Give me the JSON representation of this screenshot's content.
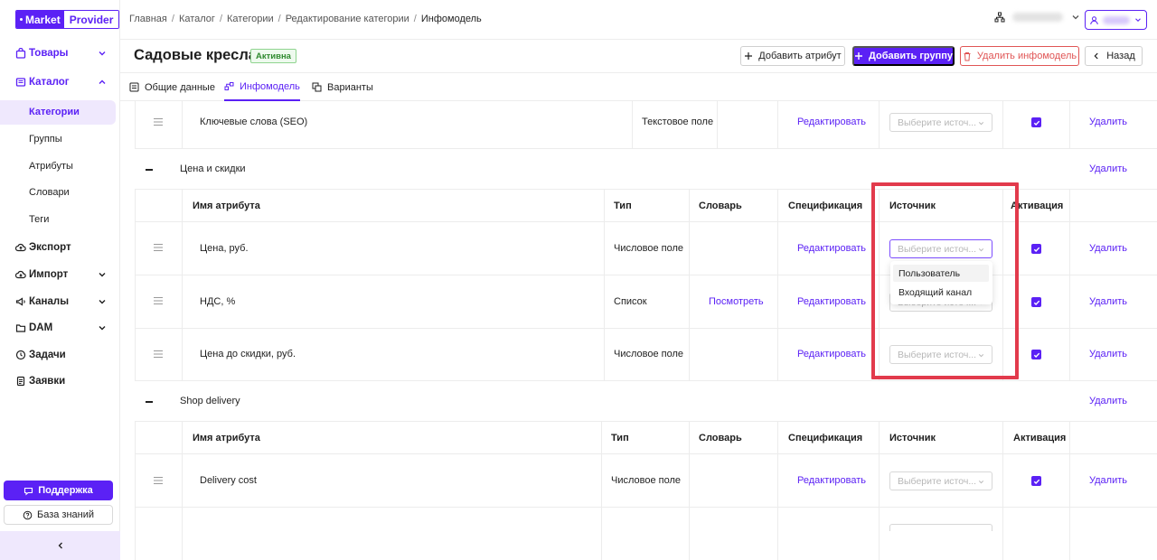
{
  "app": {
    "logo": {
      "part1": "Market",
      "part2": "Provider"
    },
    "accent": "#5b21f5"
  },
  "sidebar": {
    "items": [
      {
        "label": "Товары",
        "icon": "bag-icon"
      },
      {
        "label": "Каталог",
        "icon": "catalog-icon"
      },
      {
        "label": "Экспорт",
        "icon": "export-icon"
      },
      {
        "label": "Импорт",
        "icon": "import-icon"
      },
      {
        "label": "Каналы",
        "icon": "megaphone-icon"
      },
      {
        "label": "DAM",
        "icon": "folder-icon"
      },
      {
        "label": "Задачи",
        "icon": "clock-icon"
      },
      {
        "label": "Заявки",
        "icon": "document-icon"
      }
    ],
    "catalog_sub": [
      "Категории",
      "Группы",
      "Атрибуты",
      "Словари",
      "Теги"
    ],
    "support": "Поддержка",
    "knowledge_base": "База знаний"
  },
  "breadcrumb": [
    "Главная",
    "Каталог",
    "Категории",
    "Редактирование категории",
    "Инфомодель"
  ],
  "header": {
    "title": "Садовые кресла",
    "status": "Активна",
    "add_attribute": "Добавить атрибут",
    "add_group": "Добавить группу",
    "delete_model": "Удалить инфомодель",
    "back": "Назад"
  },
  "tabs": [
    {
      "label": "Общие данные"
    },
    {
      "label": "Инфомодель"
    },
    {
      "label": "Варианты"
    }
  ],
  "columns": {
    "name": "Имя атрибута",
    "type": "Тип",
    "dictionary": "Словарь",
    "spec": "Спецификация",
    "source": "Источник",
    "activation": "Активация"
  },
  "actions": {
    "edit": "Редактировать",
    "delete": "Удалить",
    "view": "Посмотреть"
  },
  "source_placeholder": "Выберите источ...",
  "top_row": {
    "name": "Ключевые слова (SEO)",
    "type": "Текстовое поле"
  },
  "groups": [
    {
      "title": "Цена и скидки",
      "rows": [
        {
          "name": "Цена, руб.",
          "type": "Числовое поле"
        },
        {
          "name": "НДС, %",
          "type": "Список"
        },
        {
          "name": "Цена до скидки, руб.",
          "type": "Числовое поле"
        }
      ]
    },
    {
      "title": "Shop delivery",
      "rows": [
        {
          "name": "Delivery cost",
          "type": "Числовое поле"
        }
      ]
    }
  ],
  "source_dropdown": {
    "options": [
      "Пользователь",
      "Входящий канал"
    ]
  }
}
